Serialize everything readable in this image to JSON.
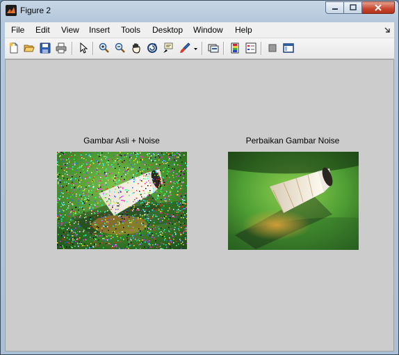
{
  "window": {
    "title": "Figure 2"
  },
  "menu": [
    "File",
    "Edit",
    "View",
    "Insert",
    "Tools",
    "Desktop",
    "Window",
    "Help"
  ],
  "toolbar_icons": [
    "new-figure-icon",
    "open-file-icon",
    "save-icon",
    "print-icon",
    "edit-plot-arrow-icon",
    "zoom-in-icon",
    "zoom-out-icon",
    "pan-hand-icon",
    "rotate-3d-icon",
    "data-cursor-icon",
    "brush-icon",
    "brush-dropdown-icon",
    "link-plot-icon",
    "insert-colorbar-icon",
    "insert-legend-icon",
    "hide-plot-tools-icon",
    "show-plot-tools-icon"
  ],
  "axes": [
    {
      "title": "Gambar Asli + Noise"
    },
    {
      "title": "Perbaikan Gambar Noise"
    }
  ],
  "colors": {
    "figure_bg": "#cccccc",
    "grass_dark": "#1f4a1a",
    "grass_light": "#7cc24a",
    "feather": "#f4ede0",
    "cork": "#2b2620"
  }
}
